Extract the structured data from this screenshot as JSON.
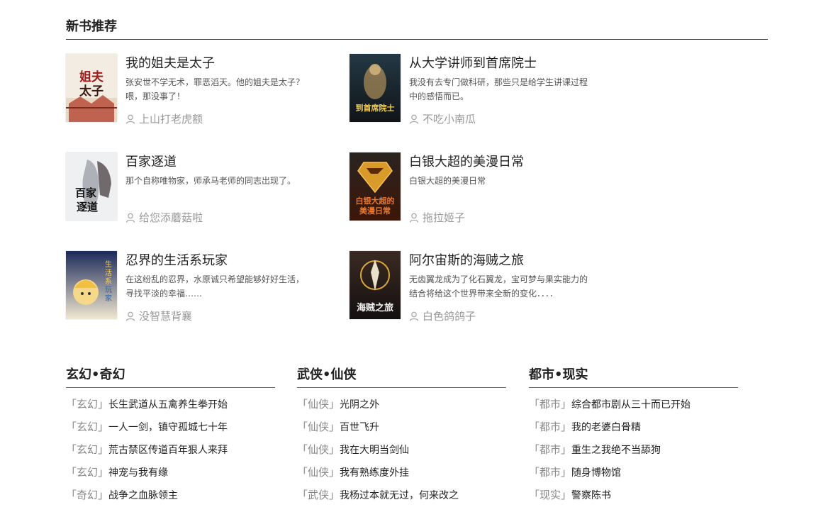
{
  "new_books": {
    "heading": "新书推荐",
    "books": [
      {
        "title": "我的姐夫是太子",
        "desc": "张安世不学无术，罪恶滔天。他的姐夫是太子？喂，那没事了！",
        "author": "上山打老虎额",
        "cover_text": "我的姐夫是太子"
      },
      {
        "title": "从大学讲师到首席院士",
        "desc": "我没有去专门做科研，那些只是给学生讲课过程中的感悟而已。",
        "author": "不吃小南瓜",
        "cover_text": "到首席院士"
      },
      {
        "title": "百家逐道",
        "desc": "那个自称唯物家，师承马老师的同志出现了。",
        "author": "给您添蘑菇啦",
        "cover_text": "百家逐道"
      },
      {
        "title": "白银大超的美漫日常",
        "desc": "白银大超的美漫日常",
        "author": "拖拉姬子",
        "cover_text": "白银大超的美漫日常"
      },
      {
        "title": "忍界的生活系玩家",
        "desc": "在这纷乱的忍界，水原诚只希望能够好好生活，寻找平淡的幸福……",
        "author": "没智慧背襄",
        "cover_text": "生活系玩家"
      },
      {
        "title": "阿尔宙斯的海贼之旅",
        "desc": "无齿翼龙成为了化石翼龙，宝可梦与果实能力的结合将给这个世界带来全新的变化．．．．",
        "author": "白色鸽鸽子",
        "cover_text": "海贼之旅"
      }
    ]
  },
  "categories": [
    {
      "heading": "玄幻•奇幻",
      "items": [
        {
          "tag": "「玄幻」",
          "name": "长生武道从五禽养生拳开始"
        },
        {
          "tag": "「玄幻」",
          "name": "一人一剑，镇守孤城七十年"
        },
        {
          "tag": "「玄幻」",
          "name": "荒古禁区传道百年狠人来拜"
        },
        {
          "tag": "「玄幻」",
          "name": "神宠与我有缘"
        },
        {
          "tag": "「奇幻」",
          "name": "战争之血脉领主"
        }
      ]
    },
    {
      "heading": "武侠•仙侠",
      "items": [
        {
          "tag": "「仙侠」",
          "name": "光阴之外"
        },
        {
          "tag": "「仙侠」",
          "name": "百世飞升"
        },
        {
          "tag": "「仙侠」",
          "name": "我在大明当剑仙"
        },
        {
          "tag": "「仙侠」",
          "name": "我有熟练度外挂"
        },
        {
          "tag": "「武侠」",
          "name": "我杨过本就无过，何来改之"
        }
      ]
    },
    {
      "heading": "都市•现实",
      "items": [
        {
          "tag": "「都市」",
          "name": "综合都市剧从三十而已开始"
        },
        {
          "tag": "「都市」",
          "name": "我的老婆白骨精"
        },
        {
          "tag": "「都市」",
          "name": "重生之我绝不当舔狗"
        },
        {
          "tag": "「都市」",
          "name": "随身博物馆"
        },
        {
          "tag": "「现实」",
          "name": "警察陈书"
        }
      ]
    }
  ]
}
